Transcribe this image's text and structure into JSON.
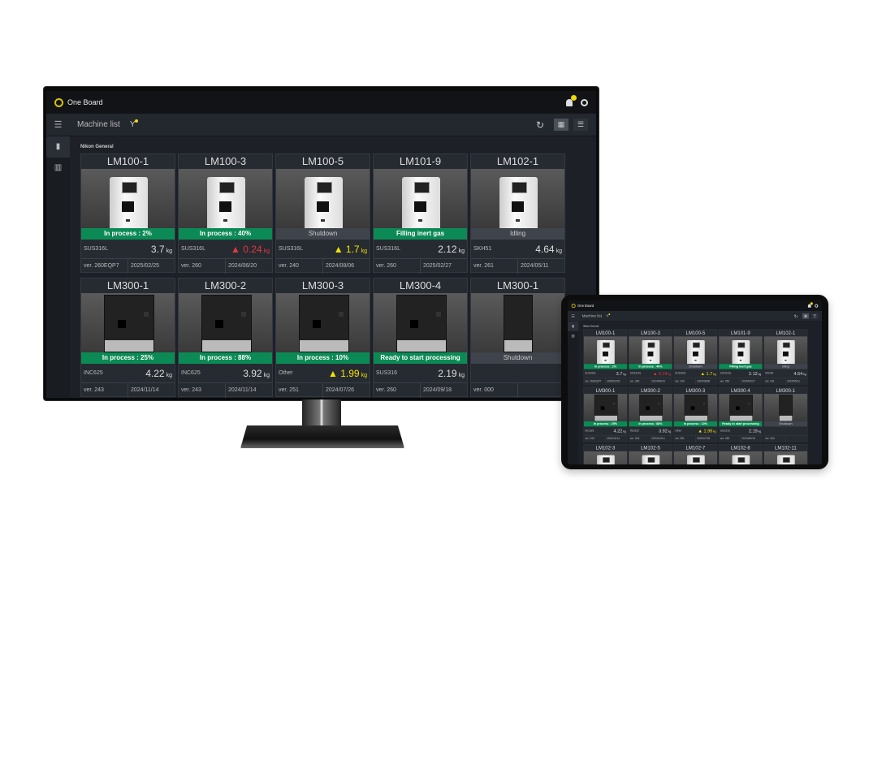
{
  "app": {
    "title": "One Board",
    "page_title": "Machine list",
    "section": "Nikon General",
    "notification_count": "!"
  },
  "icons": {
    "logo": "one-board-logo",
    "bell": "bell-icon",
    "user": "user-icon",
    "menu": "hamburger-icon",
    "filter": "filter-icon",
    "refresh": "refresh-icon",
    "grid": "grid-view-icon",
    "list": "list-view-icon",
    "machine": "machine-icon",
    "chart": "chart-icon"
  },
  "colors": {
    "status_green": "#0c8a55",
    "status_gray": "#3f444c",
    "warn_red": "#e0393c",
    "warn_yellow": "#f2e200",
    "accent": "#f0d800"
  },
  "unit": "kg",
  "machines": [
    {
      "name": "LM100-1",
      "type": "white",
      "status": "In process : 2%",
      "status_color": "green",
      "material": "SUS316L",
      "weight": "3.7",
      "warning": "",
      "version": "ver. 260EQP7",
      "date": "2025/02/25"
    },
    {
      "name": "LM100-3",
      "type": "white",
      "status": "In process : 40%",
      "status_color": "green",
      "material": "SUS316L",
      "weight": "0.24",
      "warning": "red",
      "version": "ver. 260",
      "date": "2024/06/20"
    },
    {
      "name": "LM100-5",
      "type": "white",
      "status": "Shutdown",
      "status_color": "gray",
      "material": "SUS316L",
      "weight": "1.7",
      "warning": "yellow",
      "version": "ver. 240",
      "date": "2024/08/06"
    },
    {
      "name": "LM101-9",
      "type": "white",
      "status": "Filling inert gas",
      "status_color": "green",
      "material": "SUS316L",
      "weight": "2.12",
      "warning": "",
      "version": "ver. 260",
      "date": "2025/02/27"
    },
    {
      "name": "LM102-1",
      "type": "white",
      "status": "Idling",
      "status_color": "gray",
      "material": "SKH51",
      "weight": "4.64",
      "warning": "",
      "version": "ver. 261",
      "date": "2024/05/11"
    },
    {
      "name": "LM300-1",
      "type": "black",
      "status": "In process : 25%",
      "status_color": "green",
      "material": "INC625",
      "weight": "4.22",
      "warning": "",
      "version": "ver. 243",
      "date": "2024/11/14"
    },
    {
      "name": "LM300-2",
      "type": "black",
      "status": "In process : 88%",
      "status_color": "green",
      "material": "INC625",
      "weight": "3.92",
      "warning": "",
      "version": "ver. 243",
      "date": "2024/11/14"
    },
    {
      "name": "LM300-3",
      "type": "black",
      "status": "In process : 10%",
      "status_color": "green",
      "material": "Other",
      "weight": "1.99",
      "warning": "yellow",
      "version": "ver. 251",
      "date": "2024/07/26"
    },
    {
      "name": "LM300-4",
      "type": "black",
      "status": "Ready to start processing",
      "status_color": "green",
      "material": "SUS316",
      "weight": "2.19",
      "warning": "",
      "version": "ver. 260",
      "date": "2024/09/18"
    },
    {
      "name": "LM300-1",
      "type": "narrow",
      "status": "Shutdown",
      "status_color": "gray",
      "material": "",
      "weight": "",
      "warning": "",
      "version": "ver. 000",
      "date": ""
    }
  ],
  "tablet_extra_machines": [
    {
      "name": "LM102-3",
      "type": "white"
    },
    {
      "name": "LM102-5",
      "type": "white"
    },
    {
      "name": "LM102-7",
      "type": "white"
    },
    {
      "name": "LM102-8",
      "type": "white"
    },
    {
      "name": "LM102-11",
      "type": "white"
    }
  ]
}
